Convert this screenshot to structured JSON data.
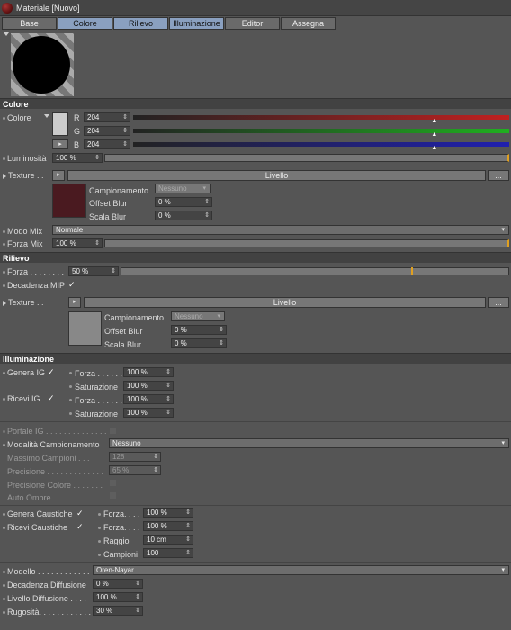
{
  "window": {
    "title": "Materiale [Nuovo]"
  },
  "tabs": [
    {
      "label": "Base"
    },
    {
      "label": "Colore"
    },
    {
      "label": "Rilievo"
    },
    {
      "label": "Illuminazione"
    },
    {
      "label": "Editor"
    },
    {
      "label": "Assegna"
    }
  ],
  "colore": {
    "header": "Colore",
    "color_label": "Colore",
    "r_label": "R",
    "r_value": "204",
    "g_label": "G",
    "g_value": "204",
    "b_label": "B",
    "b_value": "204",
    "luminosita_label": "Luminosità",
    "luminosita_value": "100 %",
    "texture_label": "Texture . .",
    "texture_button": "Livello",
    "more_button": "...",
    "campionamento_label": "Campionamento",
    "campionamento_value": "Nessuno",
    "offset_blur_label": "Offset Blur",
    "offset_blur_value": "0 %",
    "scala_blur_label": "Scala Blur",
    "scala_blur_value": "0 %",
    "modo_mix_label": "Modo Mix",
    "modo_mix_value": "Normale",
    "forza_mix_label": "Forza Mix",
    "forza_mix_value": "100 %",
    "swatch_color": "#4a1a20",
    "r_level": 0.8,
    "g_level": 0.8,
    "b_level": 0.8
  },
  "rilievo": {
    "header": "Rilievo",
    "forza_label": "Forza . . . . . . . .",
    "forza_value": "50 %",
    "forza_level": 0.5,
    "decadenza_label": "Decadenza MIP",
    "decadenza_check": "✓",
    "texture_label": "Texture . .",
    "texture_button": "Livello",
    "more_button": "...",
    "campionamento_label": "Campionamento",
    "campionamento_value": "Nessuno",
    "offset_blur_label": "Offset Blur",
    "offset_blur_value": "0 %",
    "scala_blur_label": "Scala Blur",
    "scala_blur_value": "0 %"
  },
  "illuminazione": {
    "header": "Illuminazione",
    "genera_ig_label": "Genera IG",
    "genera_ig_check": "✓",
    "ricevi_ig_label": "Ricevi IG",
    "ricevi_ig_check": "✓",
    "forza1_label": "Forza . . . . . .",
    "forza1_value": "100 %",
    "saturazione1_label": "Saturazione",
    "saturazione1_value": "100 %",
    "forza2_label": "Forza . . . . . .",
    "forza2_value": "100 %",
    "saturazione2_label": "Saturazione",
    "saturazione2_value": "100 %",
    "portale_label": "Portale IG . . . . . . . . . . . . . .",
    "modalita_label": "Modalità Campionamento",
    "modalita_value": "Nessuno",
    "massimo_label": "Massimo Campioni . . .",
    "massimo_value": "128",
    "precisione_label": "Precisione . . . . . . . . . . . . .",
    "precisione_value": "65 %",
    "precisione_colore_label": "Precisione Colore . . . . . . .",
    "auto_ombre_label": "Auto Ombre. . . . . . . . . . . . .",
    "genera_caustiche_label": "Genera Caustiche",
    "genera_caustiche_check": "✓",
    "ricevi_caustiche_label": "Ricevi Caustiche",
    "ricevi_caustiche_check": "✓",
    "forza3_label": "Forza. . . .",
    "forza3_value": "100 %",
    "forza4_label": "Forza. . . .",
    "forza4_value": "100 %",
    "raggio_label": "Raggio",
    "raggio_value": "10 cm",
    "campioni_label": "Campioni",
    "campioni_value": "100",
    "modello_label": "Modello . . . . . . . . . . . .",
    "modello_value": "Oren-Nayar",
    "decadenza_diff_label": "Decadenza Diffusione",
    "decadenza_diff_value": "0 %",
    "livello_diff_label": "Livello Diffusione . . . .",
    "livello_diff_value": "100 %",
    "rugosita_label": "Rugosità. . . . . . . . . . . .",
    "rugosita_value": "30 %"
  },
  "colors": {
    "red_bar": "#c02020",
    "green_bar": "#20b020",
    "blue_bar": "#2020b0",
    "accent_orange": "#e0a020"
  }
}
